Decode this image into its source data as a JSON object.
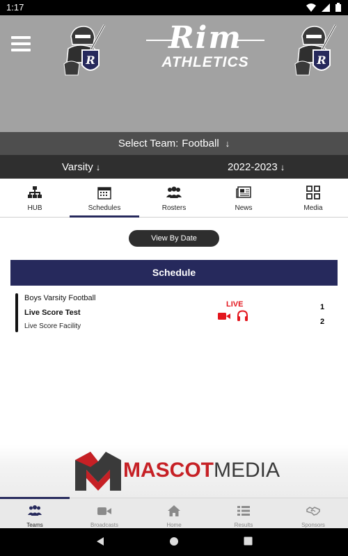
{
  "status_bar": {
    "time": "1:17",
    "icons": [
      "wifi-icon",
      "signal-icon",
      "battery-icon"
    ]
  },
  "header": {
    "menu_icon": "hamburger-icon",
    "brand_script": "Rim",
    "brand_sub": "ATHLETICS",
    "background": "#a2a2a2"
  },
  "team_select": {
    "label": "Select Team:",
    "value": "Football",
    "arrow": "↓"
  },
  "filters": {
    "level": "Varsity",
    "season": "2022-2023",
    "arrow": "↓"
  },
  "tabs": [
    {
      "label": "HUB",
      "icon": "hierarchy-icon"
    },
    {
      "label": "Schedules",
      "icon": "calendar-icon",
      "active": true
    },
    {
      "label": "Rosters",
      "icon": "people-icon"
    },
    {
      "label": "News",
      "icon": "newspaper-icon"
    },
    {
      "label": "Media",
      "icon": "grid-icon"
    }
  ],
  "view_by_date_label": "View By Date",
  "schedule": {
    "header": "Schedule",
    "accent": "#26295c",
    "events": [
      {
        "team": "Boys Varsity Football",
        "name": "Live Score Test",
        "facility": "Live Score Facility",
        "status": "LIVE",
        "status_color": "#e3161d",
        "score_1": "1",
        "score_2": "2"
      }
    ]
  },
  "sponsor": {
    "name_part1": "MASCOT",
    "name_part2": "MEDIA"
  },
  "bottom_nav": [
    {
      "label": "Teams",
      "icon": "teams-icon",
      "active": true
    },
    {
      "label": "Broadcasts",
      "icon": "video-camera-icon"
    },
    {
      "label": "Home",
      "icon": "home-icon"
    },
    {
      "label": "Results",
      "icon": "list-icon"
    },
    {
      "label": "Sponsors",
      "icon": "handshake-icon"
    }
  ],
  "system_nav": [
    "back-icon",
    "home-circle-icon",
    "recents-icon"
  ]
}
